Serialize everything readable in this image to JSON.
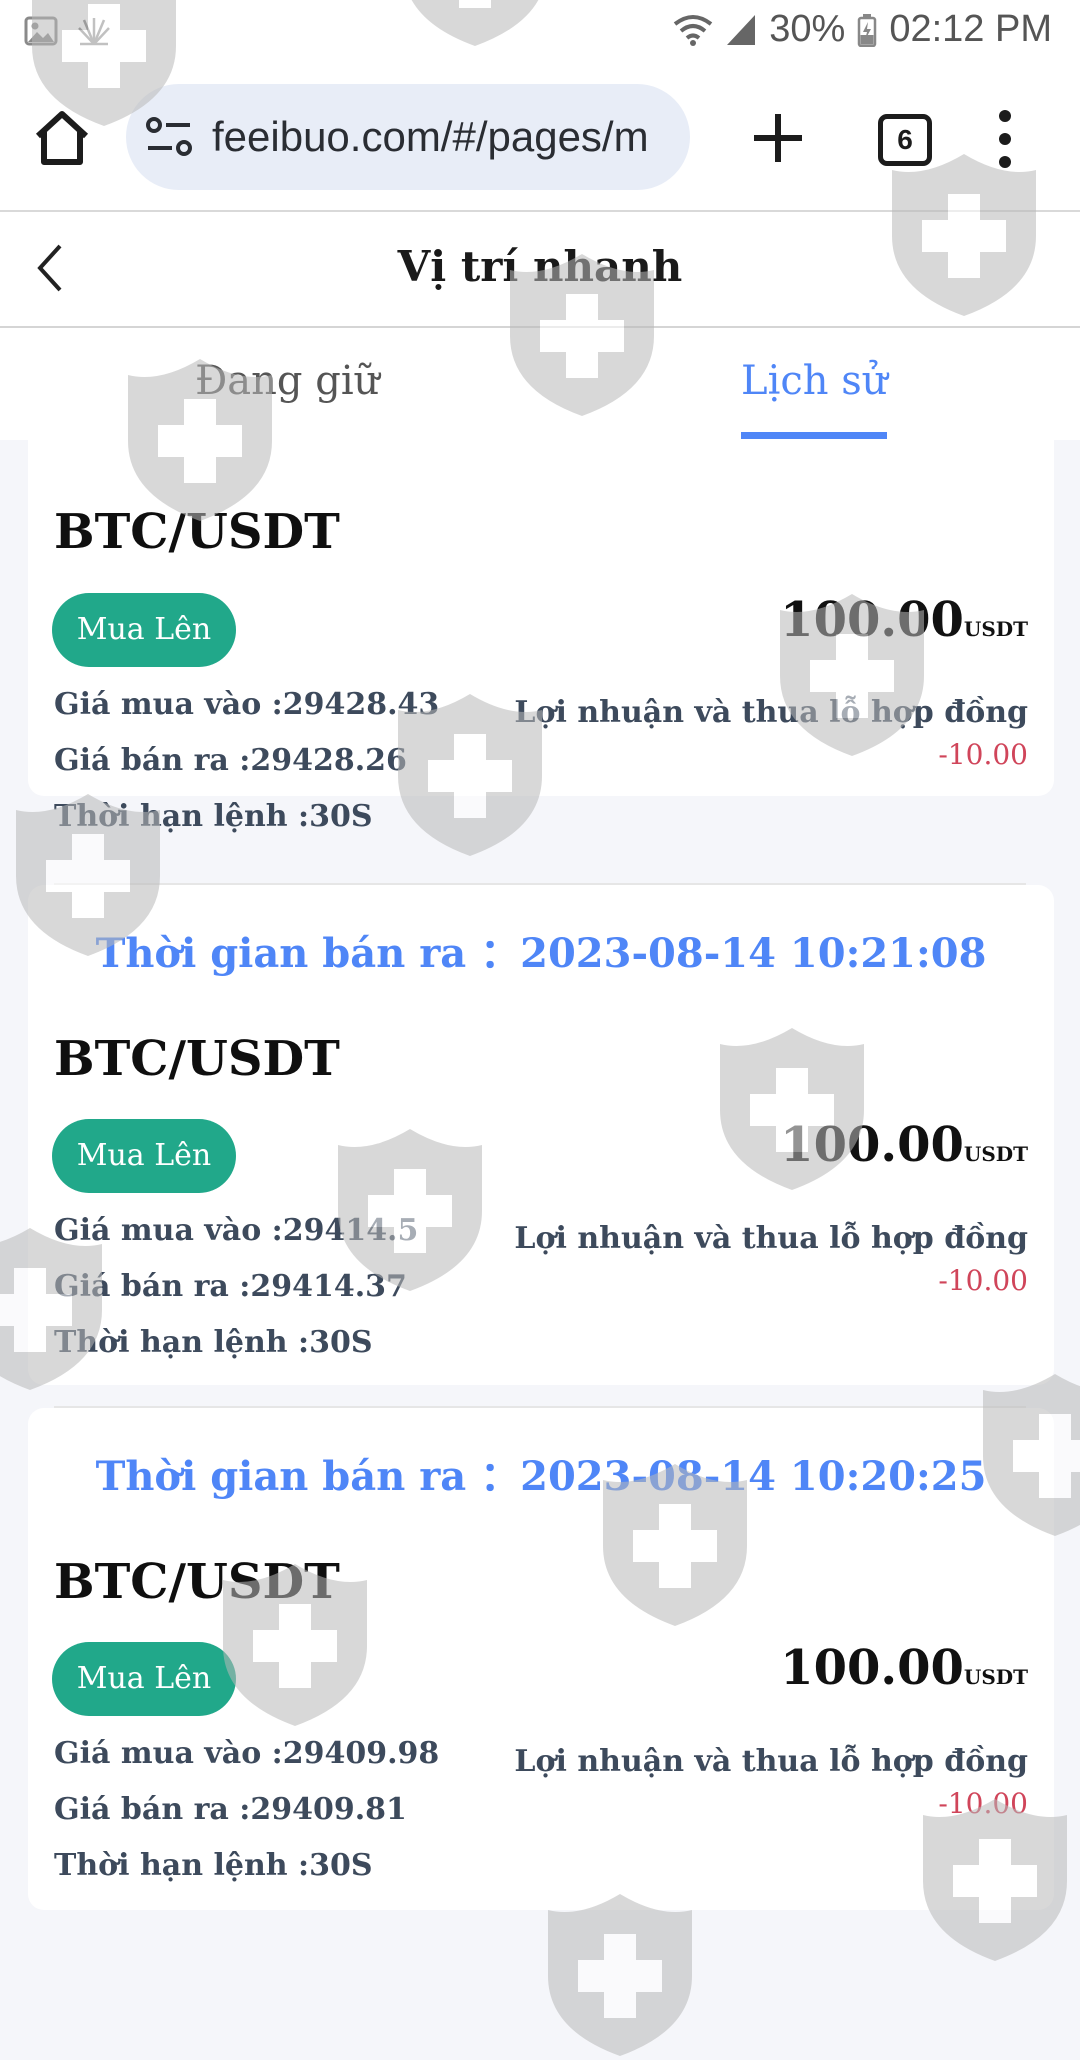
{
  "status_bar": {
    "battery": "30%",
    "time": "02:12 PM",
    "icons": [
      "gallery-icon",
      "app-icon",
      "wifi-icon",
      "signal-icon",
      "battery-icon"
    ]
  },
  "browser": {
    "url": "feeibuo.com/#/pages/m",
    "tab_count": "6"
  },
  "header": {
    "title": "Vị trí nhanh"
  },
  "tabs": [
    {
      "label": "Đang giữ",
      "active": false
    },
    {
      "label": "Lịch sử",
      "active": true
    }
  ],
  "colors": {
    "accent": "#4f86f7",
    "buy_badge": "#21a88a",
    "loss": "#d0455a"
  },
  "orders": [
    {
      "pair": "BTC/USDT",
      "direction": "Mua Lên",
      "amount": "100.00",
      "unit": "USDT",
      "buy_price": "Giá mua vào :29428.43",
      "sell_price": "Giá bán ra :29428.26",
      "duration": "Thời hạn lệnh :30S",
      "pl_label": "Lợi nhuận và thua lỗ hợp đồng",
      "pl_value": "-10.00"
    },
    {
      "sell_time": "Thời gian bán ra ：2023-08-14 10:21:08",
      "pair": "BTC/USDT",
      "direction": "Mua Lên",
      "amount": "100.00",
      "unit": "USDT",
      "buy_price": "Giá mua vào :29414.5",
      "sell_price": "Giá bán ra :29414.37",
      "duration": "Thời hạn lệnh :30S",
      "pl_label": "Lợi nhuận và thua lỗ hợp đồng",
      "pl_value": "-10.00"
    },
    {
      "sell_time": "Thời gian bán ra ：2023-08-14 10:20:25",
      "pair": "BTC/USDT",
      "direction": "Mua Lên",
      "amount": "100.00",
      "unit": "USDT",
      "buy_price": "Giá mua vào :29409.98",
      "sell_price": "Giá bán ra :29409.81",
      "duration": "Thời hạn lệnh :30S",
      "pl_label": "Lợi nhuận và thua lỗ hợp đồng",
      "pl_value": "-10.00"
    }
  ]
}
